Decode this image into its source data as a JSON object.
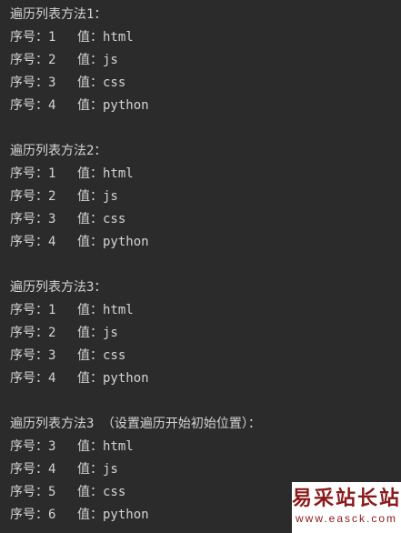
{
  "sections": [
    {
      "title": "遍历列表方法1：",
      "rows": [
        {
          "label": "序号：",
          "index": "1",
          "value_label": "值：",
          "value": "html"
        },
        {
          "label": "序号：",
          "index": "2",
          "value_label": "值：",
          "value": "js"
        },
        {
          "label": "序号：",
          "index": "3",
          "value_label": "值：",
          "value": "css"
        },
        {
          "label": "序号：",
          "index": "4",
          "value_label": "值：",
          "value": "python"
        }
      ]
    },
    {
      "title": "遍历列表方法2：",
      "rows": [
        {
          "label": "序号：",
          "index": "1",
          "value_label": "值：",
          "value": "html"
        },
        {
          "label": "序号：",
          "index": "2",
          "value_label": "值：",
          "value": "js"
        },
        {
          "label": "序号：",
          "index": "3",
          "value_label": "值：",
          "value": "css"
        },
        {
          "label": "序号：",
          "index": "4",
          "value_label": "值：",
          "value": "python"
        }
      ]
    },
    {
      "title": "遍历列表方法3：",
      "rows": [
        {
          "label": "序号：",
          "index": "1",
          "value_label": "值：",
          "value": "html"
        },
        {
          "label": "序号：",
          "index": "2",
          "value_label": "值：",
          "value": "js"
        },
        {
          "label": "序号：",
          "index": "3",
          "value_label": "值：",
          "value": "css"
        },
        {
          "label": "序号：",
          "index": "4",
          "value_label": "值：",
          "value": "python"
        }
      ]
    },
    {
      "title": "遍历列表方法3 （设置遍历开始初始位置）：",
      "rows": [
        {
          "label": "序号：",
          "index": "3",
          "value_label": "值：",
          "value": "html"
        },
        {
          "label": "序号：",
          "index": "4",
          "value_label": "值：",
          "value": "js"
        },
        {
          "label": "序号：",
          "index": "5",
          "value_label": "值：",
          "value": "css"
        },
        {
          "label": "序号：",
          "index": "6",
          "value_label": "值：",
          "value": "python"
        }
      ]
    }
  ],
  "watermark": {
    "title": "易采站长站",
    "url": "www.easck.com"
  },
  "colors": {
    "background": "#2b2b2b",
    "text": "#d4d4d4",
    "watermark_text": "#8b1a1a",
    "watermark_bg": "#ffffff"
  }
}
